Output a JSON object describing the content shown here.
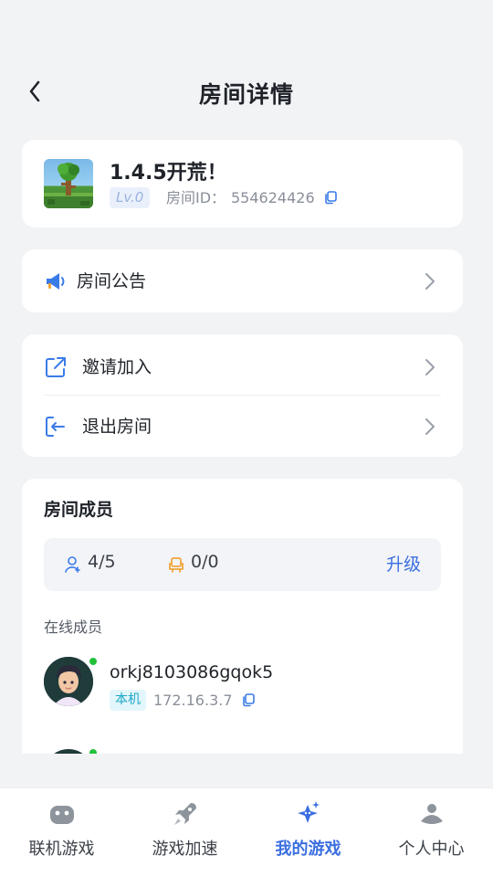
{
  "header": {
    "title": "房间详情",
    "back_icon": "chevron-left-icon"
  },
  "room": {
    "name": "1.4.5开荒！",
    "level": "Lv.0",
    "id_label": "房间ID：",
    "id_value": "554624426",
    "game_icon": "terraria-tree-icon",
    "copy_icon": "copy-icon"
  },
  "notice": {
    "label": "房间公告",
    "icon": "megaphone-icon"
  },
  "actions": [
    {
      "label": "邀请加入",
      "icon": "share-external-icon"
    },
    {
      "label": "退出房间",
      "icon": "exit-room-icon"
    }
  ],
  "members": {
    "title": "房间成员",
    "stats": {
      "members_count": "4/5",
      "seats_count": "0/0",
      "upgrade_label": "升级"
    },
    "online_label": "在线成员",
    "list": [
      {
        "name": "orkj8103086gqok5",
        "badge": "本机",
        "ip": "172.16.3.7",
        "online": true
      }
    ]
  },
  "tabbar": {
    "items": [
      {
        "label": "联机游戏",
        "icon": "gamepad-icon",
        "active": false
      },
      {
        "label": "游戏加速",
        "icon": "rocket-icon",
        "active": false
      },
      {
        "label": "我的游戏",
        "icon": "star-game-icon",
        "active": true
      },
      {
        "label": "个人中心",
        "icon": "profile-icon",
        "active": false
      }
    ]
  },
  "colors": {
    "background": "#f2f3f5",
    "accent": "#3b6fe0",
    "online": "#22c13a",
    "local_badge": "#1ba7c9"
  }
}
